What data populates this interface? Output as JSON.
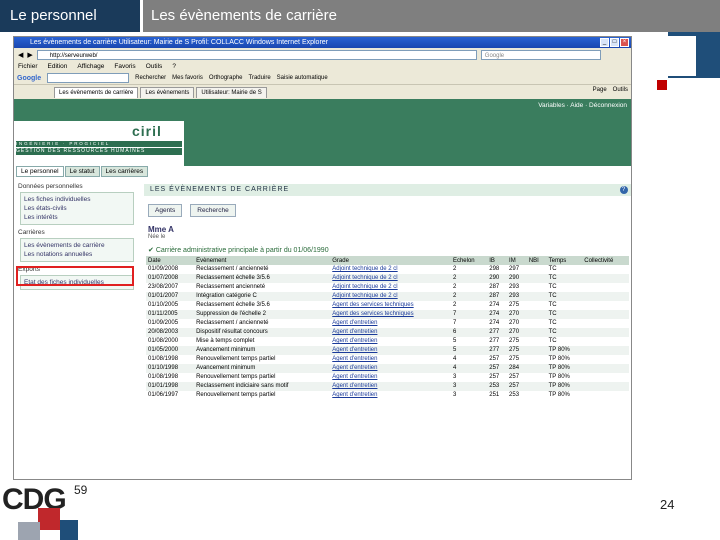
{
  "slide": {
    "header_left": "Le personnel",
    "header_right": "Les évènements de carrière",
    "page_number": "24",
    "footer_logo": "CDG",
    "footer_logo_sup": "59"
  },
  "browser": {
    "title": "Les évènements de carrière   Utilisateur: Mairie de S          Profil: COLLACC   Windows Internet Explorer",
    "address": "http://serveurweb/",
    "search_placeholder": "Google",
    "menu": [
      "Fichier",
      "Edition",
      "Affichage",
      "Favoris",
      "Outils",
      "?"
    ],
    "google_label": "Google",
    "google_items": [
      "Rechercher",
      "Mes favoris",
      "Orthographe",
      "Traduire",
      "Saisie automatique"
    ],
    "tabs": [
      "Les évènements de carrière",
      "Les évènements",
      "Utilisateur: Mairie de S"
    ],
    "tools": [
      "Page",
      "Outils"
    ]
  },
  "app": {
    "user_links": [
      "Variables",
      "Aide",
      "Déconnexion"
    ],
    "logo": "ciril",
    "logo_line1": "INGÉNIERIE · PROGICIEL",
    "logo_line2": "GESTION DES RESSOURCES HUMAINES",
    "nav_tabs": [
      "Le personnel",
      "Le statut",
      "Les carrières"
    ],
    "nav_sections": [
      {
        "head": "Données personnelles",
        "items": [
          "Les fiches individuelles",
          "Les états-civils",
          "Les intérêts"
        ]
      },
      {
        "head": "Carrières",
        "items": [
          "Les évènements de carrière",
          "Les notations annuelles"
        ]
      },
      {
        "head": "Exports",
        "items": [
          "Etat des fiches individuelles"
        ]
      }
    ],
    "panel_title": "LES ÉVÈNEMENTS DE CARRIÈRE",
    "actions": [
      "Agents",
      "Recherche"
    ],
    "person_name": "Mme A",
    "person_sub": "Née le          ",
    "career_line": "Carrière administrative principale à partir du 01/06/1990",
    "columns": [
      "Date",
      "Evènement",
      "Grade",
      "Echelon",
      "IB",
      "IM",
      "NBI",
      "Temps",
      "Collectivité"
    ],
    "rows": [
      [
        "01/09/2008",
        "Reclassement / ancienneté",
        "Adjoint technique de 2 cl",
        "2",
        "298",
        "297",
        "",
        "TC",
        ""
      ],
      [
        "01/07/2008",
        "Reclassement échelle 3/5.6",
        "Adjoint technique de 2 cl",
        "2",
        "290",
        "290",
        "",
        "TC",
        ""
      ],
      [
        "23/08/2007",
        "Reclassement ancienneté",
        "Adjoint technique de 2 cl",
        "2",
        "287",
        "293",
        "",
        "TC",
        ""
      ],
      [
        "01/01/2007",
        "Intégration catégorie C",
        "Adjoint technique de 2 cl",
        "2",
        "287",
        "293",
        "",
        "TC",
        ""
      ],
      [
        "01/10/2005",
        "Reclassement échelle 3/5.6",
        "Agent des services techniques",
        "2",
        "274",
        "275",
        "",
        "TC",
        ""
      ],
      [
        "01/11/2005",
        "Suppression de l'échelle 2",
        "Agent des services techniques",
        "7",
        "274",
        "270",
        "",
        "TC",
        ""
      ],
      [
        "01/09/2005",
        "Reclassement / ancienneté",
        "Agent d'entretien",
        "7",
        "274",
        "270",
        "",
        "TC",
        ""
      ],
      [
        "20/08/2003",
        "Dispositif résultat concours",
        "Agent d'entretien",
        "6",
        "277",
        "270",
        "",
        "TC",
        ""
      ],
      [
        "01/08/2000",
        "Mise à temps complet",
        "Agent d'entretien",
        "5",
        "277",
        "275",
        "",
        "TC",
        ""
      ],
      [
        "01/05/2000",
        "Avancement minimum",
        "Agent d'entretien",
        "5",
        "277",
        "275",
        "",
        "TP 80%",
        ""
      ],
      [
        "01/08/1998",
        "Renouvellement temps partiel",
        "Agent d'entretien",
        "4",
        "257",
        "275",
        "",
        "TP 80%",
        ""
      ],
      [
        "01/10/1998",
        "Avancement minimum",
        "Agent d'entretien",
        "4",
        "257",
        "284",
        "",
        "TP 80%",
        ""
      ],
      [
        "01/08/1998",
        "Renouvellement temps partiel",
        "Agent d'entretien",
        "3",
        "257",
        "257",
        "",
        "TP 80%",
        ""
      ],
      [
        "01/01/1998",
        "Reclassement indiciaire sans motif",
        "Agent d'entretien",
        "3",
        "253",
        "257",
        "",
        "TP 80%",
        ""
      ],
      [
        "01/06/1997",
        "Renouvellement temps partiel",
        "Agent d'entretien",
        "3",
        "251",
        "253",
        "",
        "TP 80%",
        ""
      ]
    ]
  }
}
